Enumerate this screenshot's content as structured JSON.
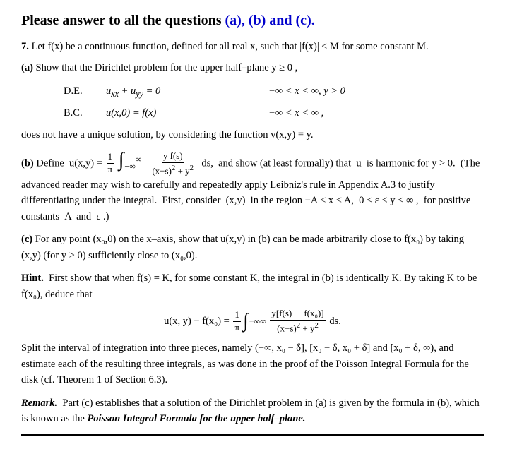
{
  "title": {
    "text": "Please answer to all the questions ",
    "colored": "(a), (b) and (c)."
  },
  "problem_number": "7.",
  "intro": "Let  f(x)  be a continuous function, defined for all real  x,  such that  |f(x)| ≤ M  for some constant  M.",
  "part_a": {
    "label": "(a)",
    "text": "Show that the Dirichlet problem for the upper half–plane  y ≥ 0 ,",
    "de_label": "D.E.",
    "de_expr": "uₓₓ + uᵧᵧ = 0",
    "de_condition": "−∞ < x < ∞, y > 0",
    "bc_label": "B.C.",
    "bc_expr": "u(x,0) = f(x)",
    "bc_condition": "−∞ < x < ∞ ,",
    "conclusion": "does not have a unique solution, by considering the function  v(x,y) ≡ y."
  },
  "part_b": {
    "label": "(b)",
    "text_before": "Define  u(x,y) = ",
    "fraction_num": "1",
    "fraction_den": "π",
    "integral_bounds_lower": "−∞",
    "integral_bounds_upper": "∞",
    "integrand_num": "y f(s)",
    "integrand_den": "(x−s)² + y²",
    "text_after": "ds,  and show (at least formally) that  u  is harmonic for  y > 0.  (The advanced reader may wish to carefully and repeatedly apply Leibniz's rule in Appendix A.3 to justify differentiating under the integral.  First, consider  (x,y)  in the region −A < x < A,  0 < ε < y < ∞ ,  for positive constants  A  and  ε .)"
  },
  "part_c": {
    "label": "(c)",
    "text": "For any point  (x₀,0)  on the x–axis, show that  u(x,y)  in  (b)  can be made arbitrarily close to f(x₀)  by taking  (x,y)  (for  y > 0)  sufficiently close to  (x₀,0)."
  },
  "hint": {
    "label": "Hint.",
    "text_1": "First show that when  f(s) = K,  for some constant  K,  the integral in  (b)  is identically K.  By taking  K  to be f(x₀),  deduce that",
    "formula_left": "u(x, y) − f(x₀) =",
    "formula_frac_num": "1",
    "formula_frac_den": "π",
    "formula_integral_lower": "−∞",
    "formula_integral_upper": "∞",
    "formula_integrand_num": "y[f(s) −  f(x₀)]",
    "formula_integrand_den": "(x−s)² + y²",
    "formula_ds": "ds.",
    "text_2": "Split the interval of integration into three pieces, namely  (−∞, x₀ − δ],  [x₀ − δ, x₀ + δ]  and [x₀ + δ, ∞),  and estimate each of the resulting three integrals, as was done in the proof of the Poisson Integral Formula for the disk (cf. Theorem 1 of Section 6.3)."
  },
  "remark": {
    "label": "Remark.",
    "text": "Part  (c)  establishes that a solution of the Dirichlet problem in  (a)  is given by the formula in  (b),  which is known as the ",
    "bold_text": "Poisson Integral Formula for the upper half–plane."
  }
}
